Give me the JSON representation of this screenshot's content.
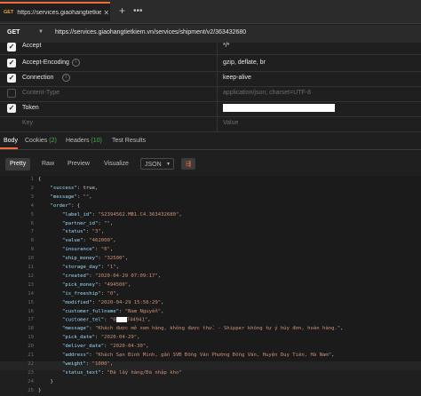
{
  "tab": {
    "method": "GET",
    "title": "https://services.giaohangtietkie..."
  },
  "url_bar": {
    "method": "GET",
    "url": "https://services.giaohangtietkiem.vn/services/shipment/v2/363432680"
  },
  "headers": [
    {
      "key": "Accept",
      "value": "*/*",
      "checked": true,
      "info": false
    },
    {
      "key": "Accept-Encoding",
      "value": "gzip, deflate, br",
      "checked": true,
      "info": true
    },
    {
      "key": "Connection",
      "value": "keep-alive",
      "checked": true,
      "info": true
    },
    {
      "key": "Content-Type",
      "value": "application/json; charset=UTF-8",
      "checked": false,
      "info": false
    },
    {
      "key": "Token",
      "value": "",
      "checked": true,
      "info": false
    },
    {
      "key": "Key",
      "value": "Value",
      "checked": null,
      "info": false
    }
  ],
  "response_tabs": [
    {
      "label": "Body",
      "count": ""
    },
    {
      "label": "Cookies",
      "count": "(2)"
    },
    {
      "label": "Headers",
      "count": "(10)"
    },
    {
      "label": "Test Results",
      "count": ""
    }
  ],
  "view_buttons": [
    "Pretty",
    "Raw",
    "Preview",
    "Visualize"
  ],
  "format": "JSON",
  "code_lines": [
    [
      [
        "pun",
        "{"
      ]
    ],
    [
      [
        "pun",
        "    "
      ],
      [
        "key",
        "\"success\""
      ],
      [
        "pun",
        ": true,"
      ]
    ],
    [
      [
        "pun",
        "    "
      ],
      [
        "key",
        "\"message\""
      ],
      [
        "pun",
        ": "
      ],
      [
        "str",
        "\"\""
      ],
      [
        "pun",
        ","
      ]
    ],
    [
      [
        "pun",
        "    "
      ],
      [
        "key",
        "\"order\""
      ],
      [
        "pun",
        ": {"
      ]
    ],
    [
      [
        "pun",
        "        "
      ],
      [
        "key",
        "\"label_id\""
      ],
      [
        "pun",
        ": "
      ],
      [
        "str",
        "\"S2394562.MB1.C4.363432680\""
      ],
      [
        "pun",
        ","
      ]
    ],
    [
      [
        "pun",
        "        "
      ],
      [
        "key",
        "\"partner_id\""
      ],
      [
        "pun",
        ": "
      ],
      [
        "str",
        "\"\""
      ],
      [
        "pun",
        ","
      ]
    ],
    [
      [
        "pun",
        "        "
      ],
      [
        "key",
        "\"status\""
      ],
      [
        "pun",
        ": "
      ],
      [
        "str",
        "\"3\""
      ],
      [
        "pun",
        ","
      ]
    ],
    [
      [
        "pun",
        "        "
      ],
      [
        "key",
        "\"value\""
      ],
      [
        "pun",
        ": "
      ],
      [
        "str",
        "\"462000\""
      ],
      [
        "pun",
        ","
      ]
    ],
    [
      [
        "pun",
        "        "
      ],
      [
        "key",
        "\"insurance\""
      ],
      [
        "pun",
        ": "
      ],
      [
        "str",
        "\"0\""
      ],
      [
        "pun",
        ","
      ]
    ],
    [
      [
        "pun",
        "        "
      ],
      [
        "key",
        "\"ship_money\""
      ],
      [
        "pun",
        ": "
      ],
      [
        "str",
        "\"32500\""
      ],
      [
        "pun",
        ","
      ]
    ],
    [
      [
        "pun",
        "        "
      ],
      [
        "key",
        "\"storage_day\""
      ],
      [
        "pun",
        ": "
      ],
      [
        "str",
        "\"1\""
      ],
      [
        "pun",
        ","
      ]
    ],
    [
      [
        "pun",
        "        "
      ],
      [
        "key",
        "\"created\""
      ],
      [
        "pun",
        ": "
      ],
      [
        "str",
        "\"2020-04-29 07:09:17\""
      ],
      [
        "pun",
        ","
      ]
    ],
    [
      [
        "pun",
        "        "
      ],
      [
        "key",
        "\"pick_money\""
      ],
      [
        "pun",
        ": "
      ],
      [
        "str",
        "\"494500\""
      ],
      [
        "pun",
        ","
      ]
    ],
    [
      [
        "pun",
        "        "
      ],
      [
        "key",
        "\"is_freeship\""
      ],
      [
        "pun",
        ": "
      ],
      [
        "str",
        "\"0\""
      ],
      [
        "pun",
        ","
      ]
    ],
    [
      [
        "pun",
        "        "
      ],
      [
        "key",
        "\"modified\""
      ],
      [
        "pun",
        ": "
      ],
      [
        "str",
        "\"2020-04-29 15:56:29\""
      ],
      [
        "pun",
        ","
      ]
    ],
    [
      [
        "pun",
        "        "
      ],
      [
        "key",
        "\"customer_fullname\""
      ],
      [
        "pun",
        ": "
      ],
      [
        "str",
        "\"Nam Nguyễn\""
      ],
      [
        "pun",
        ","
      ]
    ],
    [
      [
        "pun",
        "        "
      ],
      [
        "key",
        "\"customer_tel\""
      ],
      [
        "pun",
        ": "
      ],
      [
        "str",
        "\"0"
      ],
      [
        "redact",
        ""
      ],
      [
        "str",
        "744941\""
      ],
      [
        "pun",
        ","
      ]
    ],
    [
      [
        "pun",
        "        "
      ],
      [
        "key",
        "\"message\""
      ],
      [
        "pun",
        ": "
      ],
      [
        "str",
        "\"Khách được mở xem hàng, không được thử. - Shipper không tự ý hủy đơn, hoàn hàng.\""
      ],
      [
        "pun",
        ","
      ]
    ],
    [
      [
        "pun",
        "        "
      ],
      [
        "key",
        "\"pick_date\""
      ],
      [
        "pun",
        ": "
      ],
      [
        "str",
        "\"2020-04-29\""
      ],
      [
        "pun",
        ","
      ]
    ],
    [
      [
        "pun",
        "        "
      ],
      [
        "key",
        "\"deliver_date\""
      ],
      [
        "pun",
        ": "
      ],
      [
        "str",
        "\"2020-04-30\""
      ],
      [
        "pun",
        ","
      ]
    ],
    [
      [
        "pun",
        "        "
      ],
      [
        "key",
        "\"address\""
      ],
      [
        "pun",
        ": "
      ],
      [
        "str",
        "\"Khách Sạn Bình Minh, gần SVĐ Đồng Văn Phường Đồng Văn, Huyện Duy Tiên, Hà Nam\""
      ],
      [
        "pun",
        ","
      ]
    ],
    [
      [
        "pun",
        "        "
      ],
      [
        "key",
        "\"weight\""
      ],
      [
        "pun",
        ": "
      ],
      [
        "str",
        "\"1000\""
      ],
      [
        "pun",
        ","
      ]
    ],
    [
      [
        "pun",
        "        "
      ],
      [
        "key",
        "\"status_text\""
      ],
      [
        "pun",
        ": "
      ],
      [
        "str",
        "\"Đã lấy hàng/Đã nhập kho\""
      ]
    ],
    [
      [
        "pun",
        "    }"
      ]
    ],
    [
      [
        "pun",
        "}"
      ]
    ]
  ],
  "colors": {
    "accent": "#f26b3a",
    "method": "#e9a33b",
    "count": "#4caf50"
  }
}
